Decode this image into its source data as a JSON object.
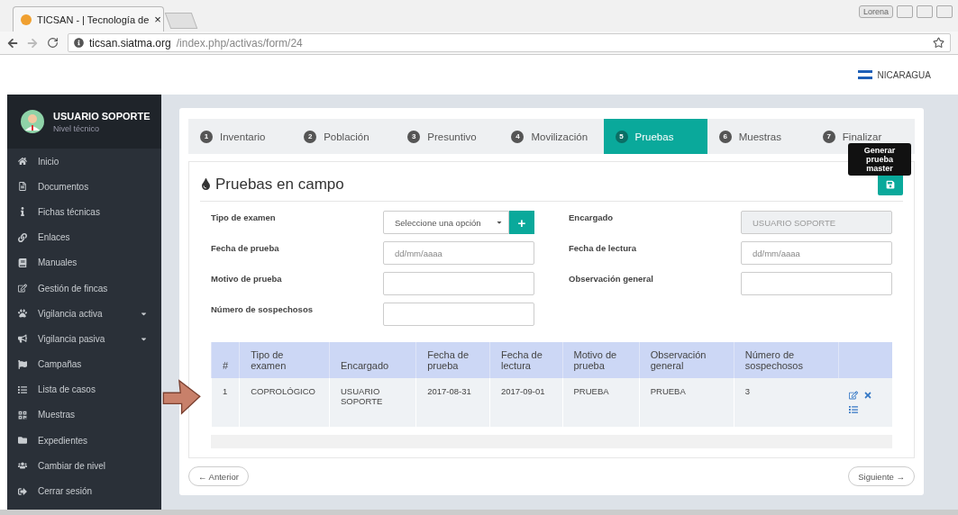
{
  "browser": {
    "tab_title": "TICSAN - | Tecnología de",
    "tab_close": "×",
    "user": "Lorena",
    "url_host": "ticsan.siatma.org",
    "url_path": "/index.php/activas/form/24"
  },
  "header": {
    "country": "NICARAGUA"
  },
  "sidebar": {
    "user_name": "USUARIO SOPORTE",
    "user_level": "Nivel técnico",
    "items": [
      {
        "label": "Inicio",
        "expandable": false
      },
      {
        "label": "Documentos",
        "expandable": false
      },
      {
        "label": "Fichas técnicas",
        "expandable": false
      },
      {
        "label": "Enlaces",
        "expandable": false
      },
      {
        "label": "Manuales",
        "expandable": false
      },
      {
        "label": "Gestión de fincas",
        "expandable": false
      },
      {
        "label": "Vigilancia activa",
        "expandable": true
      },
      {
        "label": "Vigilancia pasiva",
        "expandable": true
      },
      {
        "label": "Campañas",
        "expandable": false
      },
      {
        "label": "Lista de casos",
        "expandable": false
      },
      {
        "label": "Muestras",
        "expandable": false
      },
      {
        "label": "Expedientes",
        "expandable": false
      },
      {
        "label": "Cambiar de nivel",
        "expandable": false
      },
      {
        "label": "Cerrar sesión",
        "expandable": false
      }
    ]
  },
  "steps": [
    {
      "number": "1",
      "label": "Inventario",
      "selected": false
    },
    {
      "number": "2",
      "label": "Población",
      "selected": false
    },
    {
      "number": "3",
      "label": "Presuntivo",
      "selected": false
    },
    {
      "number": "4",
      "label": "Movilización",
      "selected": false
    },
    {
      "number": "5",
      "label": "Pruebas",
      "selected": true
    },
    {
      "number": "6",
      "label": "Muestras",
      "selected": false
    },
    {
      "number": "7",
      "label": "Finalizar",
      "selected": false
    }
  ],
  "section": {
    "title": "Pruebas en campo",
    "save_tooltip": "Generar prueba master"
  },
  "form": {
    "left": [
      {
        "label": "Tipo de examen",
        "kind": "select",
        "placeholder": "Seleccione una opción",
        "add_button": "+"
      },
      {
        "label": "Fecha de prueba",
        "kind": "input",
        "placeholder": "dd/mm/aaaa"
      },
      {
        "label": "Motivo de prueba",
        "kind": "input"
      },
      {
        "label": "Número de sospechosos",
        "kind": "input"
      }
    ],
    "right": [
      {
        "label": "Encargado",
        "kind": "disabled",
        "value": "USUARIO SOPORTE"
      },
      {
        "label": "Fecha de lectura",
        "kind": "input",
        "placeholder": "dd/mm/aaaa"
      },
      {
        "label": "Observación general",
        "kind": "input"
      }
    ]
  },
  "table": {
    "columns": [
      "#",
      "Tipo de examen",
      "Encargado",
      "Fecha de prueba",
      "Fecha de lectura",
      "Motivo de prueba",
      "Observación general",
      "Número de sospechosos"
    ],
    "rows": [
      {
        "cells": [
          "1",
          "COPROLÓGICO",
          "USUARIO SOPORTE",
          "2017-08-31",
          "2017-09-01",
          "PRUEBA",
          "PRUEBA",
          "3"
        ]
      }
    ]
  },
  "nav": {
    "previous": "← Anterior",
    "next": "Siguiente →"
  }
}
